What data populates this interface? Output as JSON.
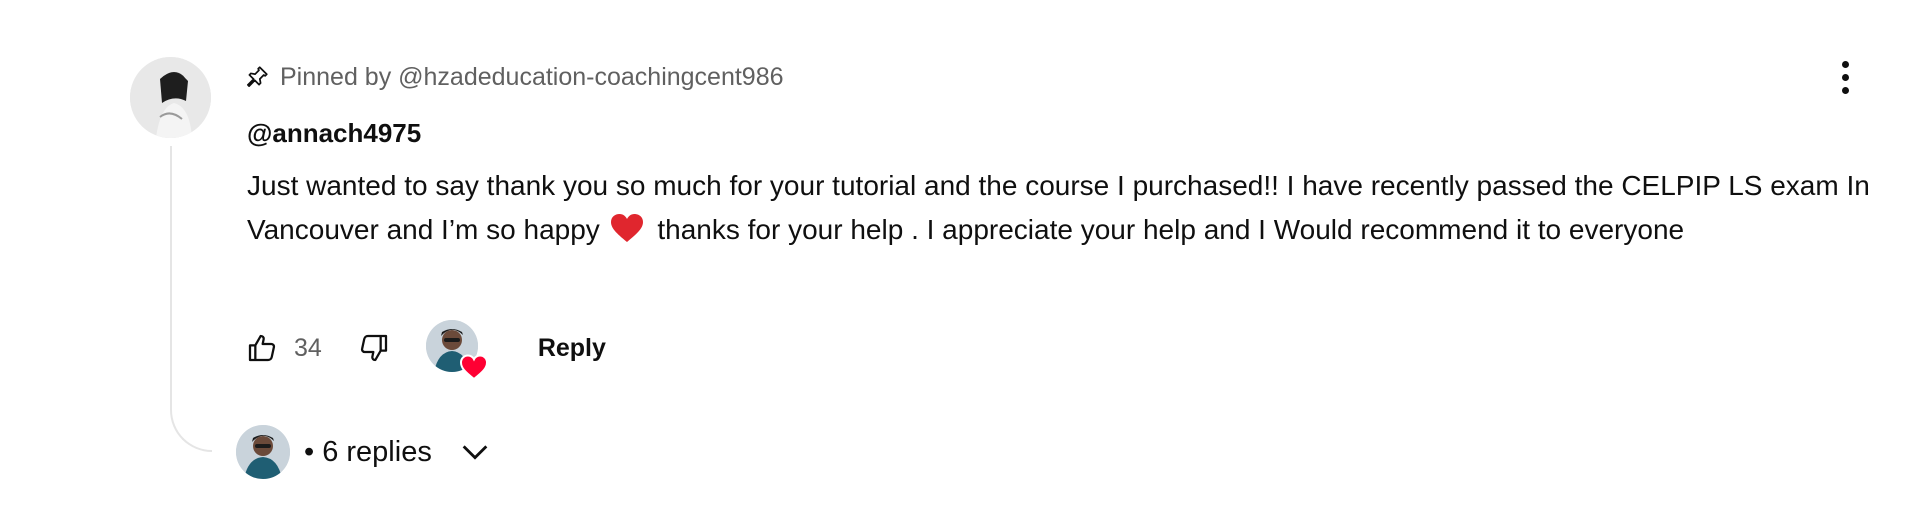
{
  "comment": {
    "pinned_label": "Pinned by @hzadeducation-coachingcent986",
    "author": "@annach4975",
    "text_before_emoji": "Just wanted to say thank you so much for your tutorial and the course I purchased!! I have recently passed the CELPIP LS exam In Vancouver and I’m so happy ",
    "text_after_emoji": " thanks for your help . I appreciate your help and I Would recommend it to everyone",
    "emoji": "red-heart-emoji",
    "like_count": "34",
    "reply_label": "Reply",
    "replies_label": "• 6 replies"
  },
  "icons": {
    "pin": "pin-icon",
    "menu": "more-vertical-icon",
    "like": "thumbs-up-icon",
    "dislike": "thumbs-down-icon",
    "creator_heart": "creator-heart-badge",
    "expand": "chevron-down-icon"
  },
  "colors": {
    "heart": "#ff0033",
    "secondary_text": "#606060",
    "primary_text": "#0f0f0f",
    "thread_line": "#e5e5e5"
  }
}
